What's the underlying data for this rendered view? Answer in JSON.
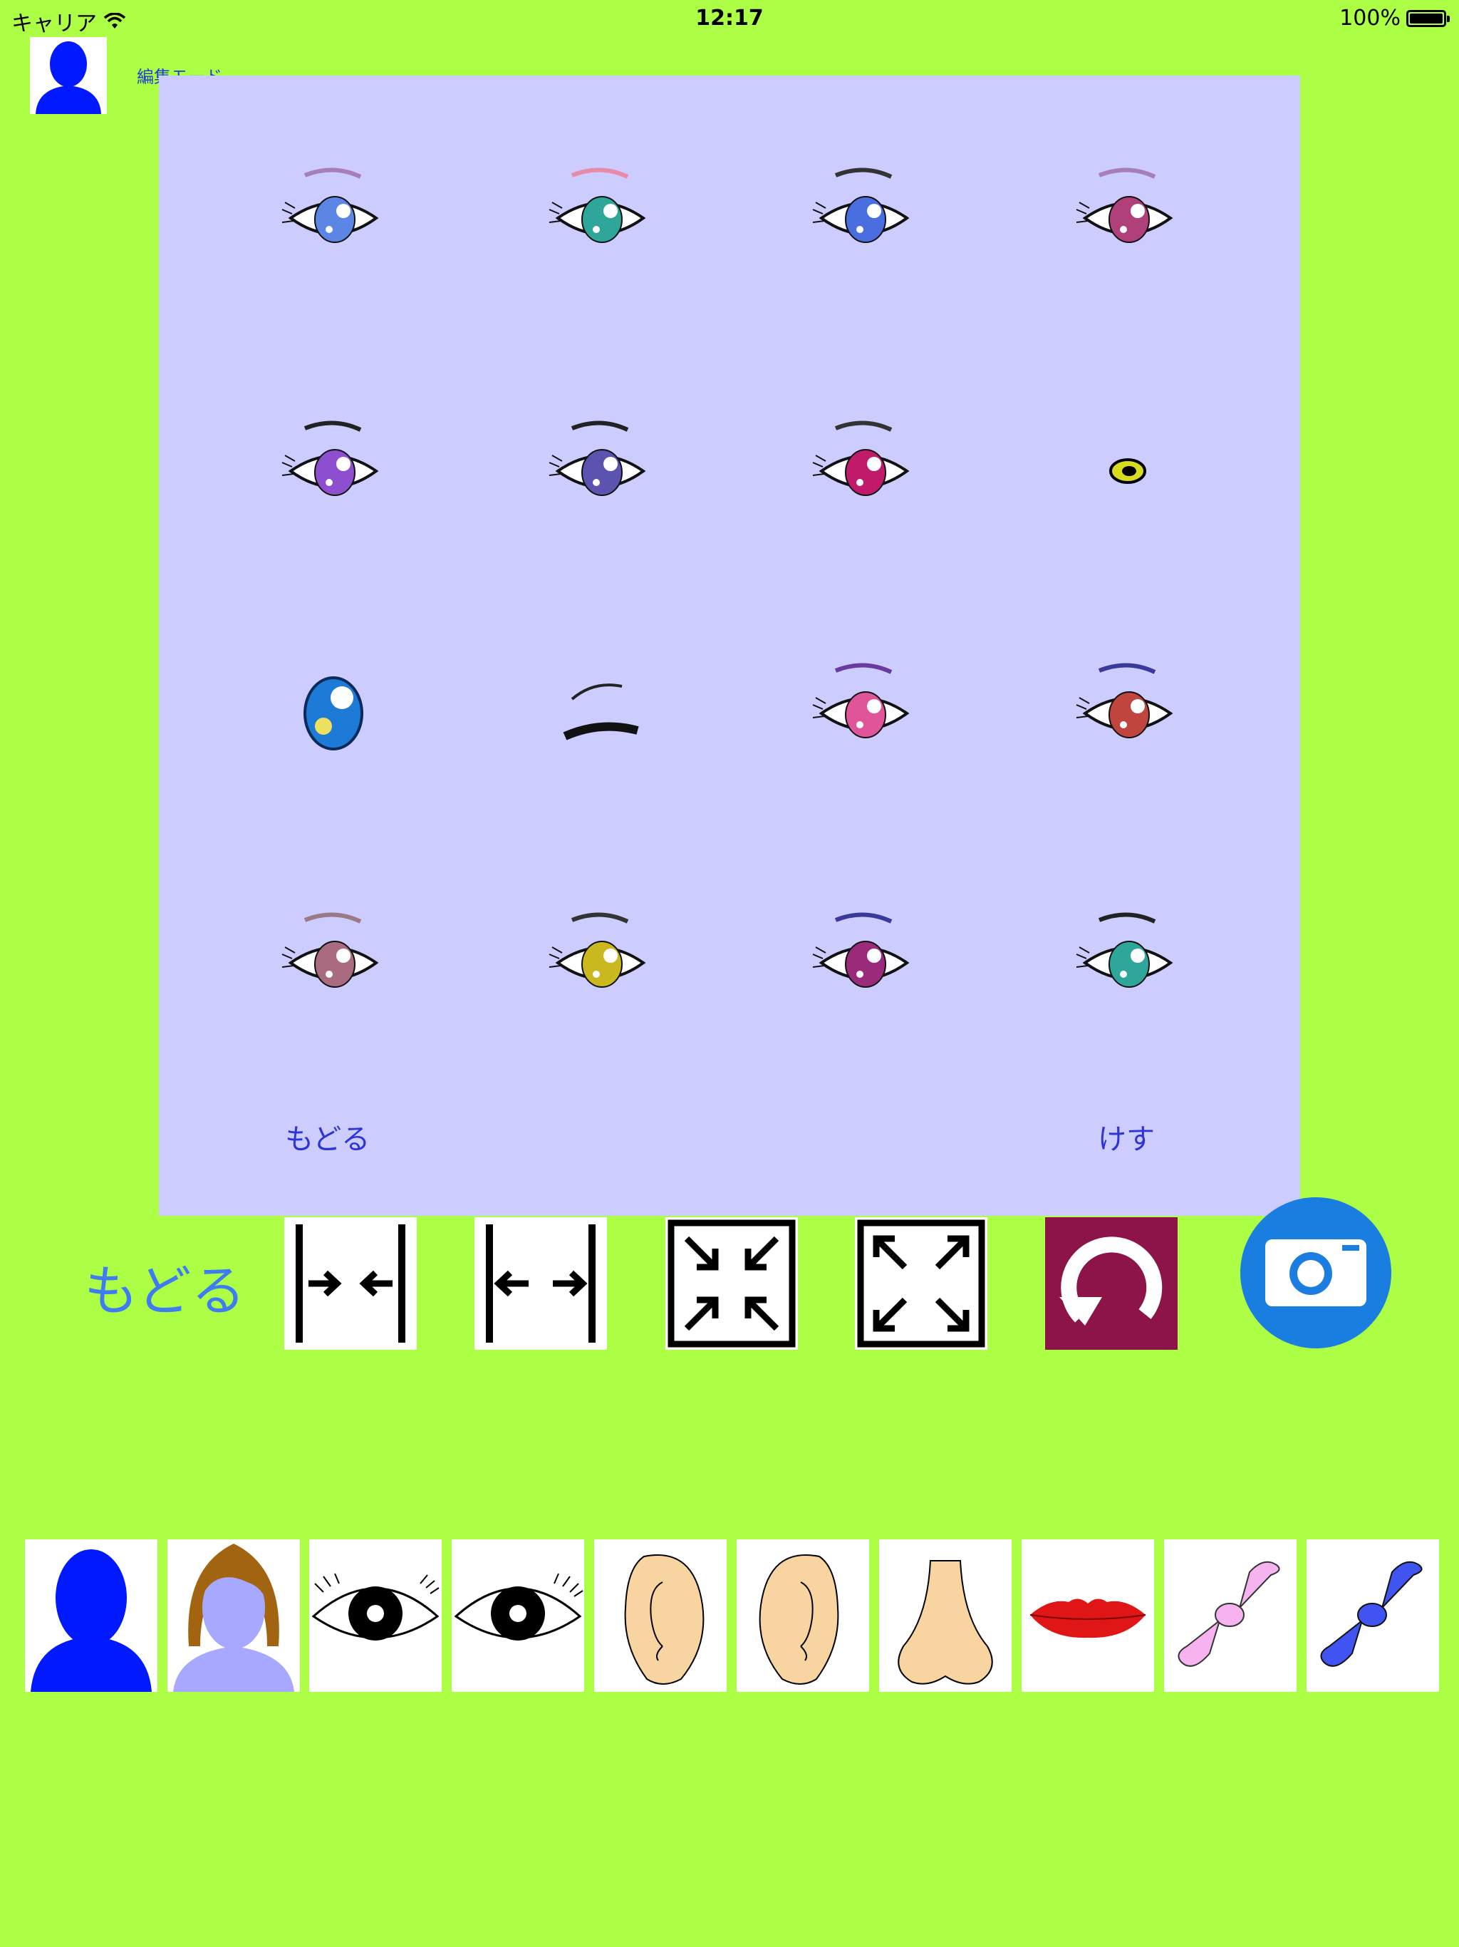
{
  "status_bar": {
    "carrier": "キャリア",
    "time": "12:17",
    "battery": "100%"
  },
  "header": {
    "mode_label": "編集モード"
  },
  "picker": {
    "back_label": "もどる",
    "erase_label": "けす",
    "eyes": [
      {
        "iris": "#5b86e5",
        "brow": "#a57fb6"
      },
      {
        "iris": "#2ea79a",
        "brow": "#e98aa6"
      },
      {
        "iris": "#4a6ee0",
        "brow": "#333333"
      },
      {
        "iris": "#b0407a",
        "brow": "#a57fb6"
      },
      {
        "iris": "#8d4fd0",
        "brow": "#222222"
      },
      {
        "iris": "#5c52b0",
        "brow": "#222222"
      },
      {
        "iris": "#c01a6a",
        "brow": "#333333"
      },
      {
        "iris": "#222222",
        "brow": ""
      },
      {
        "iris": "#1d7ad6",
        "brow": ""
      },
      {
        "iris": "#222222",
        "brow": "#222222"
      },
      {
        "iris": "#e0559a",
        "brow": "#6a3aa0"
      },
      {
        "iris": "#c0453f",
        "brow": "#3a3a9a"
      },
      {
        "iris": "#a86b80",
        "brow": "#9a7a86"
      },
      {
        "iris": "#c9b81e",
        "brow": "#333333"
      },
      {
        "iris": "#9a2a7a",
        "brow": "#3a3a9a"
      },
      {
        "iris": "#2ea79a",
        "brow": "#222222"
      }
    ]
  },
  "toolbar": {
    "back_label": "もどる",
    "tools": [
      {
        "icon": "narrow-icon"
      },
      {
        "icon": "widen-icon"
      },
      {
        "icon": "shrink-icon"
      },
      {
        "icon": "enlarge-icon"
      },
      {
        "icon": "rotate-icon"
      }
    ],
    "camera_icon": "camera-icon",
    "accent": "#3d7cf2"
  },
  "parts": [
    {
      "icon": "face-silhouette-icon"
    },
    {
      "icon": "hair-icon"
    },
    {
      "icon": "left-eye-icon"
    },
    {
      "icon": "right-eye-icon"
    },
    {
      "icon": "left-ear-icon"
    },
    {
      "icon": "right-ear-icon"
    },
    {
      "icon": "nose-icon"
    },
    {
      "icon": "lips-icon"
    },
    {
      "icon": "pink-ribbon-icon"
    },
    {
      "icon": "blue-ribbon-icon"
    }
  ],
  "colors": {
    "background": "#adff45",
    "panel": "#ccccff",
    "link": "#2e34d8"
  }
}
